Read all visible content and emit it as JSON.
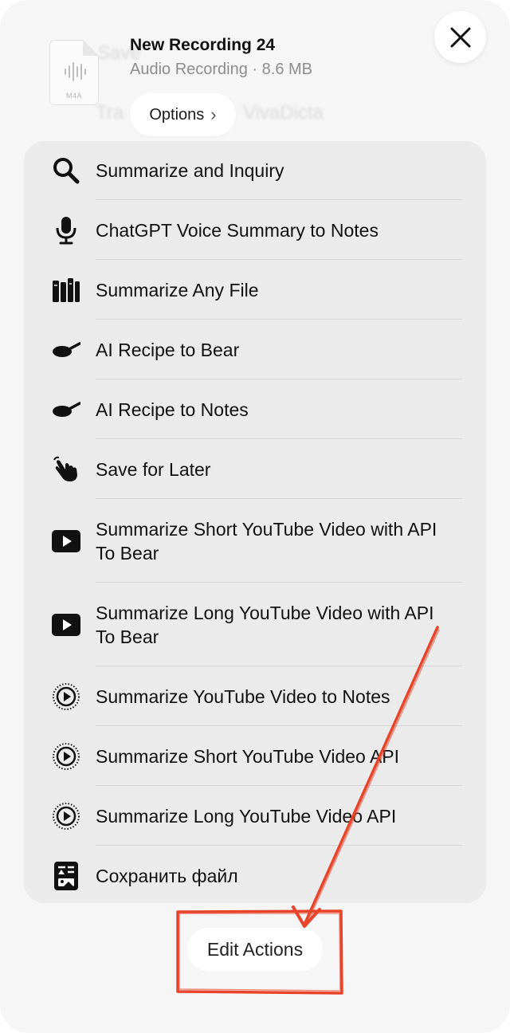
{
  "background_ghost": {
    "lines": [
      "Tra",
      "VivaDicta",
      "Save"
    ]
  },
  "file": {
    "name": "New Recording 24",
    "kind_size": "Audio Recording · 8.6 MB",
    "extension": "M4A",
    "icon": "waveform-icon"
  },
  "options": {
    "label": "Options",
    "chevron": "›"
  },
  "close": {
    "icon": "close-icon"
  },
  "actions": [
    {
      "label": "Summarize and Inquiry",
      "icon": "magnifier-icon"
    },
    {
      "label": "ChatGPT Voice Summary to Notes",
      "icon": "microphone-icon"
    },
    {
      "label": "Summarize Any File",
      "icon": "books-icon"
    },
    {
      "label": "AI Recipe to Bear",
      "icon": "frying-pan-icon"
    },
    {
      "label": "AI Recipe to Notes",
      "icon": "frying-pan-icon"
    },
    {
      "label": "Save for Later",
      "icon": "hand-tap-icon"
    },
    {
      "label": "Summarize Short YouTube Video with API To Bear",
      "icon": "youtube-play-icon"
    },
    {
      "label": "Summarize Long YouTube Video with API To Bear",
      "icon": "youtube-play-icon"
    },
    {
      "label": "Summarize YouTube Video to Notes",
      "icon": "play-circle-dotted-icon"
    },
    {
      "label": "Summarize Short YouTube Video API",
      "icon": "play-circle-dotted-icon"
    },
    {
      "label": "Summarize Long YouTube Video API",
      "icon": "play-circle-dotted-icon"
    },
    {
      "label": "Сохранить файл",
      "icon": "document-text-image-icon"
    }
  ],
  "edit_actions": {
    "label": "Edit Actions"
  },
  "annotation": {
    "color": "#e8442a"
  }
}
